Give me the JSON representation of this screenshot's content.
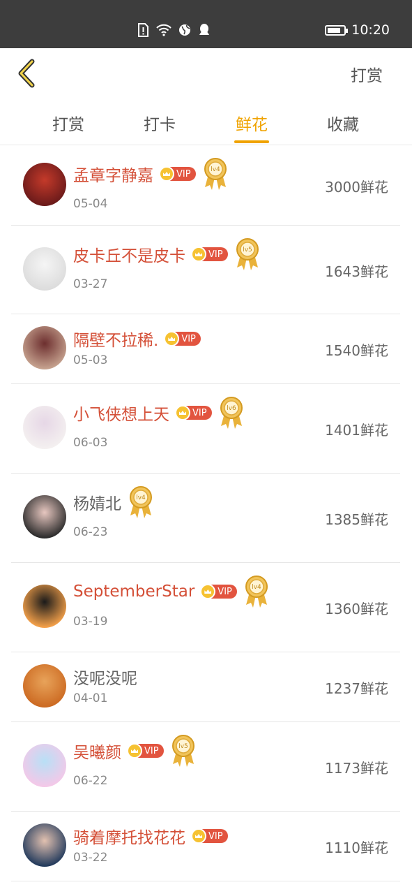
{
  "status_bar": {
    "time": "10:20",
    "icons": [
      "sim-alert-icon",
      "wifi-icon",
      "globe-icon",
      "qq-icon",
      "battery-icon"
    ]
  },
  "header": {
    "back_icon": "chevron-left-icon",
    "title": "打赏"
  },
  "tabs": [
    {
      "label": "打赏",
      "active": false
    },
    {
      "label": "打卡",
      "active": false
    },
    {
      "label": "鲜花",
      "active": true
    },
    {
      "label": "收藏",
      "active": false
    }
  ],
  "colors": {
    "accent": "#f0a300",
    "vip_name": "#d45038",
    "vip_badge": "#e2543f",
    "status_bar": "#3d3d3d"
  },
  "vip_label": "VIP",
  "rows": [
    {
      "name": "孟章字静嘉",
      "date": "05-04",
      "amount": "3000鲜花",
      "vip": true,
      "level": "lv4"
    },
    {
      "name": "皮卡丘不是皮卡",
      "date": "03-27",
      "amount": "1643鲜花",
      "vip": true,
      "level": "lv5"
    },
    {
      "name": "隔壁不拉稀.",
      "date": "05-03",
      "amount": "1540鲜花",
      "vip": true,
      "level": ""
    },
    {
      "name": "小飞侠想上天",
      "date": "06-03",
      "amount": "1401鲜花",
      "vip": true,
      "level": "lv6"
    },
    {
      "name": "杨婧北",
      "date": "06-23",
      "amount": "1385鲜花",
      "vip": false,
      "level": "lv4"
    },
    {
      "name": "SeptemberStar",
      "date": "03-19",
      "amount": "1360鲜花",
      "vip": true,
      "level": "lv4"
    },
    {
      "name": "没呢没呢",
      "date": "04-01",
      "amount": "1237鲜花",
      "vip": false,
      "level": ""
    },
    {
      "name": "吴曦颜",
      "date": "06-22",
      "amount": "1173鲜花",
      "vip": true,
      "level": "lv5"
    },
    {
      "name": "骑着摩托找花花",
      "date": "03-22",
      "amount": "1110鲜花",
      "vip": true,
      "level": ""
    }
  ]
}
